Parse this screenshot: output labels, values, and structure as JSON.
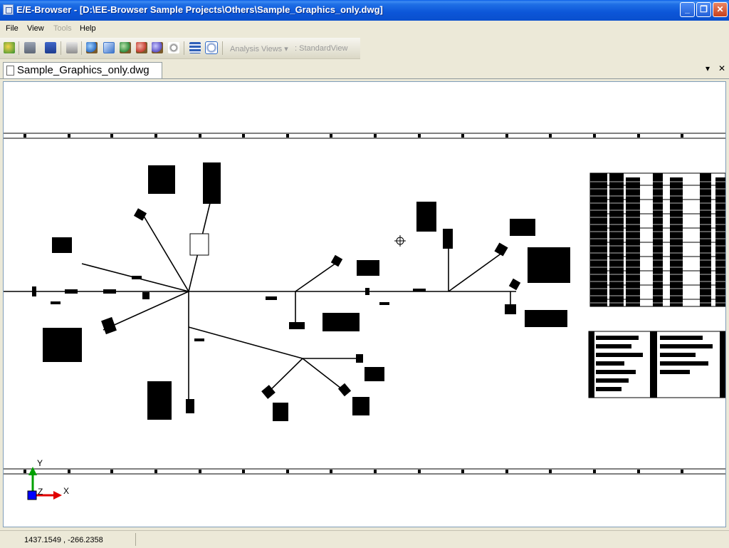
{
  "window": {
    "title": "E/E-Browser - [D:\\EE-Browser Sample Projects\\Others\\Sample_Graphics_only.dwg]"
  },
  "window_controls": {
    "minimize": "_",
    "restore": "❐",
    "close": "✕"
  },
  "menu": {
    "file": "File",
    "view": "View",
    "tools": "Tools",
    "help": "Help"
  },
  "toolbar": {
    "icons": [
      "open-icon",
      "save-icon",
      "save-all-icon",
      "print-icon",
      "zoom-icon",
      "zoom-extents-icon",
      "zoom-in-icon",
      "zoom-out-icon",
      "zoom-previous-icon",
      "pan-icon",
      "layers-icon",
      "regen-icon"
    ],
    "analysis_views": "Analysis Views",
    "standard_view": "StandardView"
  },
  "document_tab": {
    "label": "Sample_Graphics_only.dwg"
  },
  "tab_controls": {
    "dropdown": "▾",
    "close": "✕"
  },
  "axes": {
    "y": "Y",
    "z": "Z",
    "x": "X"
  },
  "status": {
    "coordinates": "1437.1549 , -266.2358"
  },
  "colors": {
    "title_bar": "#0a4fcd",
    "chrome": "#ece9d8",
    "drawing": "#000000",
    "y_axis": "#00a000",
    "x_axis": "#e00000",
    "ucs_box": "#0000ff"
  }
}
